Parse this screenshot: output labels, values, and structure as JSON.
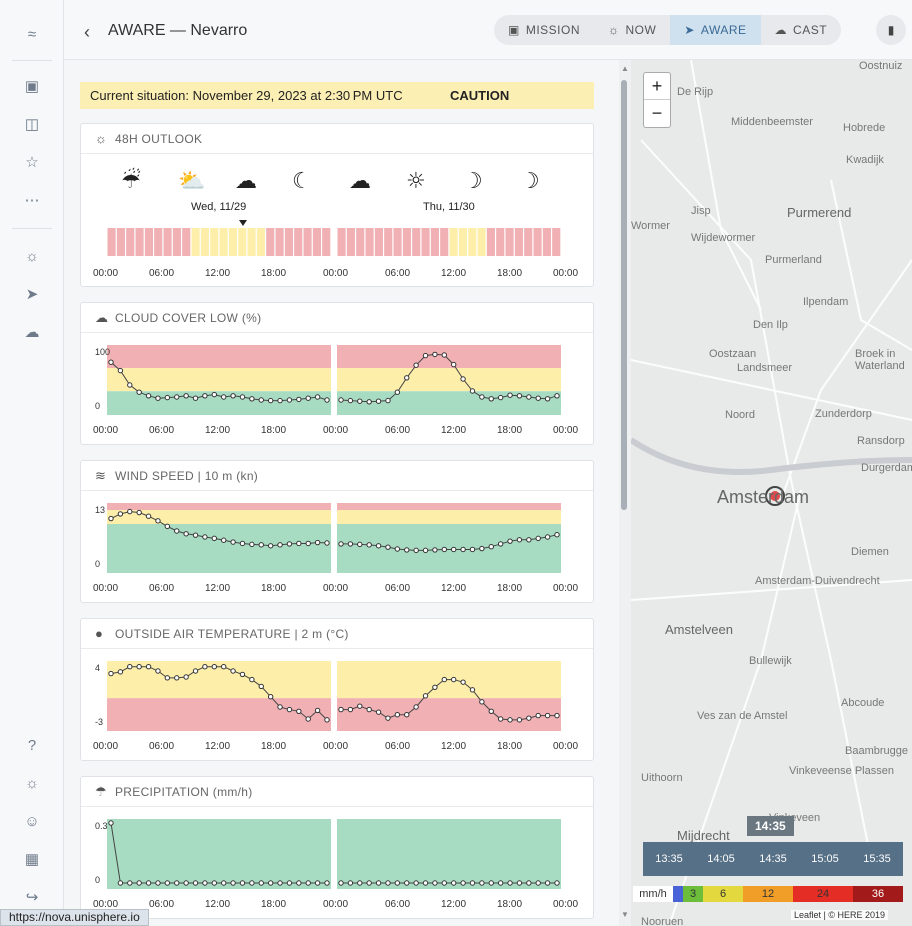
{
  "header": {
    "back_icon": "chevron-left-icon",
    "title": "AWARE — Nevarro",
    "modes": [
      {
        "label": "MISSION",
        "icon": "book-icon"
      },
      {
        "label": "NOW",
        "icon": "weather-now-icon"
      },
      {
        "label": "AWARE",
        "icon": "rocket-icon",
        "active": true
      },
      {
        "label": "CAST",
        "icon": "forecast-icon"
      }
    ],
    "map_toggle_icon": "map-icon"
  },
  "status_bar": {
    "text": "Current situation: November 29, 2023 at 2:30 PM UTC",
    "level": "CAUTION"
  },
  "outlook": {
    "title": "48H OUTLOOK",
    "day1": "Wed, 11/29",
    "day2": "Thu, 11/30",
    "times": [
      "00:00",
      "06:00",
      "12:00",
      "18:00",
      "00:00",
      "06:00",
      "12:00",
      "18:00",
      "00:00"
    ],
    "weather_icons": [
      "rain-cloud-icon",
      "sun-cloud-icon",
      "cloud-icon",
      "night-cloud-icon",
      "cloud-icon",
      "sunrise-cloud-icon",
      "moon-stars-icon",
      "moon-stars-icon"
    ]
  },
  "cloud": {
    "title": "CLOUD COVER LOW",
    "unit": "(%)",
    "ymax": "100",
    "ymin": "0"
  },
  "wind": {
    "title": "WIND SPEED",
    "sub": "10 m",
    "unit": "(kn)",
    "ymax": "13",
    "ymin": "0"
  },
  "temp": {
    "title": "OUTSIDE AIR TEMPERATURE",
    "sub": "2 m",
    "unit": "(°C)",
    "ymax": "4",
    "ymin": "-3"
  },
  "precip": {
    "title": "PRECIPITATION",
    "unit": "(mm/h)",
    "ymax": "0.3",
    "ymin": "0"
  },
  "chart_data": [
    {
      "type": "line",
      "title": "CLOUD COVER LOW",
      "ylim": [
        0,
        100
      ],
      "x_ticks": [
        "00:00",
        "06:00",
        "12:00",
        "18:00",
        "00:00",
        "06:00",
        "12:00",
        "18:00",
        "00:00"
      ],
      "series": [
        {
          "values": [
            78,
            64,
            40,
            28,
            22,
            18,
            19,
            20,
            22,
            18,
            22,
            24,
            20,
            22,
            20,
            17,
            15,
            14,
            14,
            15,
            16,
            18,
            20,
            15,
            15,
            14,
            13,
            12,
            13,
            14,
            28,
            52,
            73,
            89,
            91,
            90,
            74,
            50,
            30,
            20,
            17,
            19,
            23,
            22,
            20,
            18,
            17,
            22
          ]
        }
      ]
    },
    {
      "type": "line",
      "title": "WIND SPEED",
      "ylim": [
        0,
        13
      ],
      "x_ticks": [
        "00:00",
        "06:00",
        "12:00",
        "18:00",
        "00:00",
        "06:00",
        "12:00",
        "18:00",
        "00:00"
      ],
      "series": [
        {
          "values": [
            10.5,
            11.5,
            12.0,
            11.8,
            11.0,
            10.0,
            8.8,
            7.8,
            7.2,
            6.9,
            6.5,
            6.2,
            5.8,
            5.4,
            5.1,
            4.9,
            4.8,
            4.6,
            4.8,
            5.0,
            5.1,
            5.1,
            5.3,
            5.2,
            5.0,
            5.0,
            4.9,
            4.8,
            4.6,
            4.3,
            3.9,
            3.7,
            3.6,
            3.6,
            3.7,
            3.8,
            3.8,
            3.8,
            3.8,
            4.0,
            4.4,
            5.0,
            5.6,
            5.9,
            5.9,
            6.2,
            6.5,
            7.0
          ]
        }
      ]
    },
    {
      "type": "line",
      "title": "OUTSIDE AIR TEMPERATURE",
      "ylim": [
        -3,
        4
      ],
      "x_ticks": [
        "00:00",
        "06:00",
        "12:00",
        "18:00",
        "00:00",
        "06:00",
        "12:00",
        "18:00",
        "00:00"
      ],
      "series": [
        {
          "values": [
            3.0,
            3.2,
            3.8,
            3.8,
            3.8,
            3.3,
            2.5,
            2.5,
            2.6,
            3.3,
            3.8,
            3.8,
            3.8,
            3.3,
            2.9,
            2.3,
            1.5,
            0.3,
            -0.9,
            -1.2,
            -1.4,
            -2.3,
            -1.3,
            -2.4,
            -1.2,
            -1.2,
            -0.8,
            -1.2,
            -1.5,
            -2.2,
            -1.8,
            -1.8,
            -0.9,
            0.4,
            1.4,
            2.3,
            2.3,
            2.0,
            1.1,
            -0.3,
            -1.4,
            -2.3,
            -2.4,
            -2.4,
            -2.2,
            -1.9,
            -1.9,
            -1.9
          ]
        }
      ]
    },
    {
      "type": "line",
      "title": "PRECIPITATION",
      "ylim": [
        0,
        0.3
      ],
      "x_ticks": [
        "00:00",
        "06:00",
        "12:00",
        "18:00",
        "00:00",
        "06:00",
        "12:00",
        "18:00",
        "00:00"
      ],
      "series": [
        {
          "values": [
            0.3,
            0,
            0,
            0,
            0,
            0,
            0,
            0,
            0,
            0,
            0,
            0,
            0,
            0,
            0,
            0,
            0,
            0,
            0,
            0,
            0,
            0,
            0,
            0,
            0,
            0,
            0,
            0,
            0,
            0,
            0,
            0,
            0,
            0,
            0,
            0,
            0,
            0,
            0,
            0,
            0,
            0,
            0,
            0,
            0,
            0,
            0,
            0
          ]
        }
      ]
    }
  ],
  "map": {
    "zoom_in": "+",
    "zoom_out": "−",
    "labels": [
      "De Rijp",
      "Oostnuiz",
      "Middenbeemster",
      "Hobrede",
      "Kwadijk",
      "Purmerend",
      "Jisp",
      "Wormer",
      "Wijdewormer",
      "Purmerland",
      "Ilpendam",
      "Den Ilp",
      "Oostzaan",
      "Landsmeer",
      "Broek in Waterland",
      "Noord",
      "Zunderdorp",
      "Ransdorp",
      "Amsterdam",
      "Durgerdam",
      "Diemen",
      "Amsterdam-Duivendrecht",
      "Amstelveen",
      "Bullewijk",
      "Abcoude",
      "Ves zan de Amstel",
      "Baambrugge",
      "Uithoorn",
      "Vinkeveense Plassen",
      "Mijdrecht",
      "Vinkeveen",
      "Nooruen"
    ],
    "current_time": "14:35",
    "times": [
      "13:35",
      "14:05",
      "14:35",
      "15:05",
      "15:35"
    ],
    "legend_unit": "mm/h",
    "legend_steps": [
      "3",
      "6",
      "12",
      "24",
      "36"
    ],
    "legend_colors": [
      "#e0e0ff",
      "#6bbd3a",
      "#e3d93e",
      "#f09e28",
      "#e32d25",
      "#a31a1a"
    ],
    "attribution": "Leaflet | © HERE 2019"
  },
  "status_url": "https://nova.unisphere.io",
  "rail_icons": [
    "dashboard-icon",
    "map-icon",
    "star-icon",
    "group-icon",
    "weather-icon",
    "rocket-icon",
    "forecast-icon",
    "help-icon",
    "settings-sun-icon",
    "users-settings-icon",
    "building-icon",
    "logout-icon"
  ],
  "colors": {
    "green": "#a8dcc2",
    "yellow": "#fdeeaa",
    "red": "#f0b0b4"
  }
}
